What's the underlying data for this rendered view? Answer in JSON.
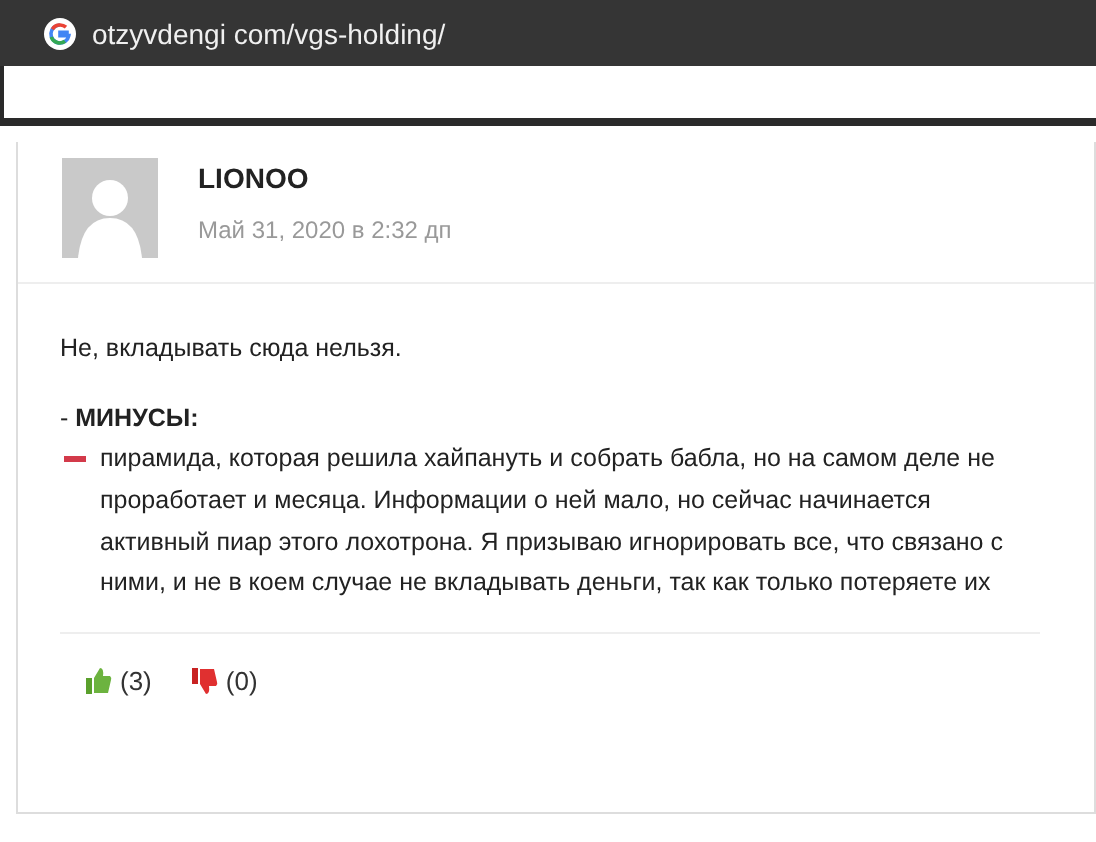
{
  "address_bar": {
    "url": "otzyvdengi com/vgs-holding/"
  },
  "comment": {
    "author": "LIONOO",
    "date": "Май 31, 2020 в 2:32 дп",
    "lead": "Не, вкладывать сюда нельзя.",
    "cons_heading": "- **МИНУСЫ:**",
    "cons_text": "пирамида, которая решила хайпануть и собрать бабла, но на самом деле не проработает и месяца. Информации о ней мало, но сейчас начинается активный пиар этого лохотрона. Я призываю игнорировать все, что связано с ними, и не в коем случае не вкладывать деньги, так как только потеряете их",
    "votes": [
      {
        "kind": "up",
        "count": "(3)"
      },
      {
        "kind": "down",
        "count": "(0)"
      }
    ]
  }
}
